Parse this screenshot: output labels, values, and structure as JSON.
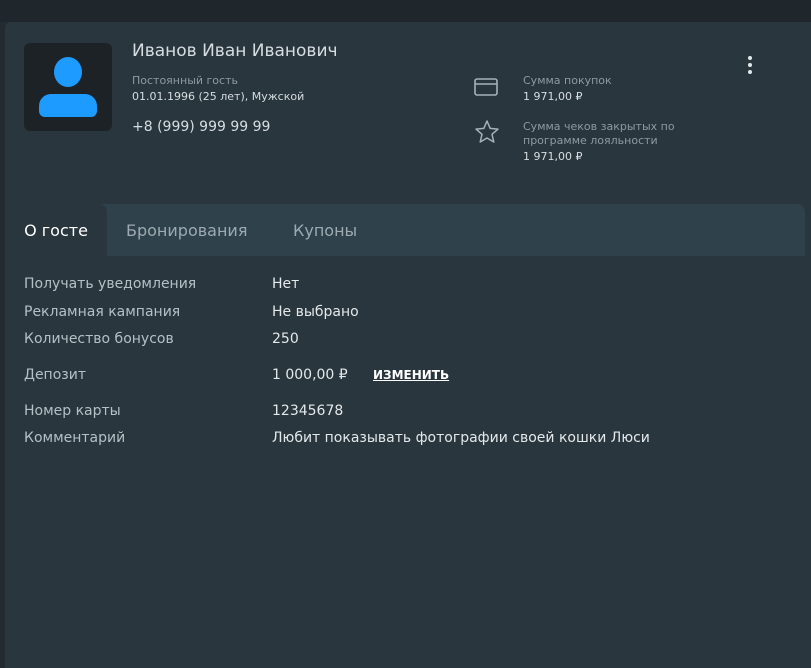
{
  "guest": {
    "name": "Иванов Иван Иванович",
    "status": "Постоянный гость",
    "birth_info": "01.01.1996 (25 лет), Мужской",
    "phone": "+8 (999) 999 99 99"
  },
  "stats": {
    "purchases_label": "Сумма покупок",
    "purchases_value": "1 971,00 ₽",
    "loyalty_label": "Сумма чеков закрытых по программе лояльности",
    "loyalty_value": "1 971,00 ₽"
  },
  "tabs": [
    {
      "label": "О госте",
      "active": true
    },
    {
      "label": "Бронирования",
      "active": false
    },
    {
      "label": "Купоны",
      "active": false
    }
  ],
  "details": {
    "notifications_label": "Получать уведомления",
    "notifications_value": "Нет",
    "campaign_label": "Рекламная кампания",
    "campaign_value": "Не выбрано",
    "bonus_label": "Количество бонусов",
    "bonus_value": "250",
    "deposit_label": "Депозит",
    "deposit_value": "1 000,00 ₽",
    "deposit_action": "ИЗМЕНИТЬ",
    "card_label": "Номер карты",
    "card_value": "12345678",
    "comment_label": "Комментарий",
    "comment_value": "Любит показывать фотографии своей кошки Люси"
  },
  "icons": {
    "avatar": "person-avatar",
    "purchases": "credit-card-icon",
    "loyalty": "star-icon",
    "menu": "more-vertical-icon"
  },
  "colors": {
    "background": "#232b31",
    "card": "#29363d",
    "tab_bar": "#2f424b",
    "avatar_accent": "#1e9bff",
    "text_primary": "#d6dde2",
    "text_muted": "#8e9aa2"
  }
}
